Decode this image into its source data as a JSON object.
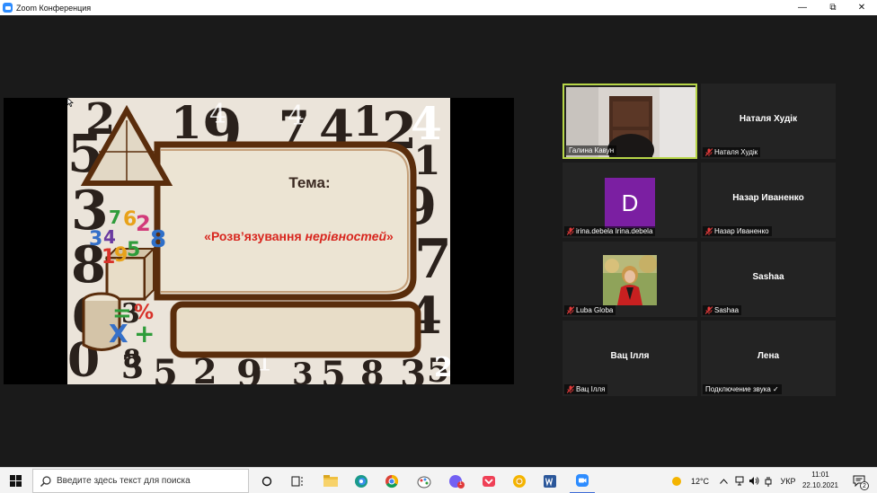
{
  "window": {
    "title": "Zoom Конференция"
  },
  "controls": {
    "minimize": "—",
    "restore": "⧉",
    "close": "✕"
  },
  "slide": {
    "title": "Тема:",
    "subtitle_part1": "«Розв’язування ",
    "subtitle_part2": "нерівностей",
    "subtitle_part3": "»",
    "numbers": [
      "2",
      "1",
      "9",
      "7",
      "4",
      "1",
      "2",
      "4",
      "1",
      "9",
      "7",
      "4",
      "5",
      "3",
      "8",
      "6",
      "0",
      "3",
      "5",
      "2",
      "9",
      "3",
      "5",
      "8",
      "3",
      "5",
      "2",
      "3",
      "8"
    ],
    "colorful_digits": [
      "7",
      "6",
      "2",
      "8",
      "3",
      "4",
      "1",
      "9",
      "5"
    ],
    "symbols": [
      "=",
      "%",
      "X",
      "+"
    ]
  },
  "participants": [
    {
      "name": "Галина Кавун",
      "muted": false,
      "active": true,
      "video": true
    },
    {
      "name": "Наталя Худік",
      "muted": true,
      "active": false,
      "video": false
    },
    {
      "name": "irina.debela Irina.debela",
      "muted": true,
      "avatar_letter": "D",
      "avatar_color": "#7b1fa2"
    },
    {
      "name": "Назар Иваненко",
      "muted": true,
      "active": false,
      "video": false
    },
    {
      "name": "Luba Globa",
      "muted": true,
      "photo": true
    },
    {
      "name": "Sashaa",
      "muted": true,
      "active": false,
      "video": false
    },
    {
      "name": "Вац Ілля",
      "muted": true,
      "active": false,
      "video": false
    },
    {
      "name": "Лена",
      "status": "Подключение звука ✓",
      "muted": false
    }
  ],
  "taskbar": {
    "search_placeholder": "Введите здесь текст для поиска",
    "weather": "12°C",
    "language": "УКР",
    "time": "11:01",
    "date": "22.10.2021",
    "notifications": "2",
    "viber_badge": "1"
  },
  "colors": {
    "active_border": "#b7d648",
    "muted_icon": "#e03a3a",
    "slide_frame": "#5a2d0c"
  }
}
